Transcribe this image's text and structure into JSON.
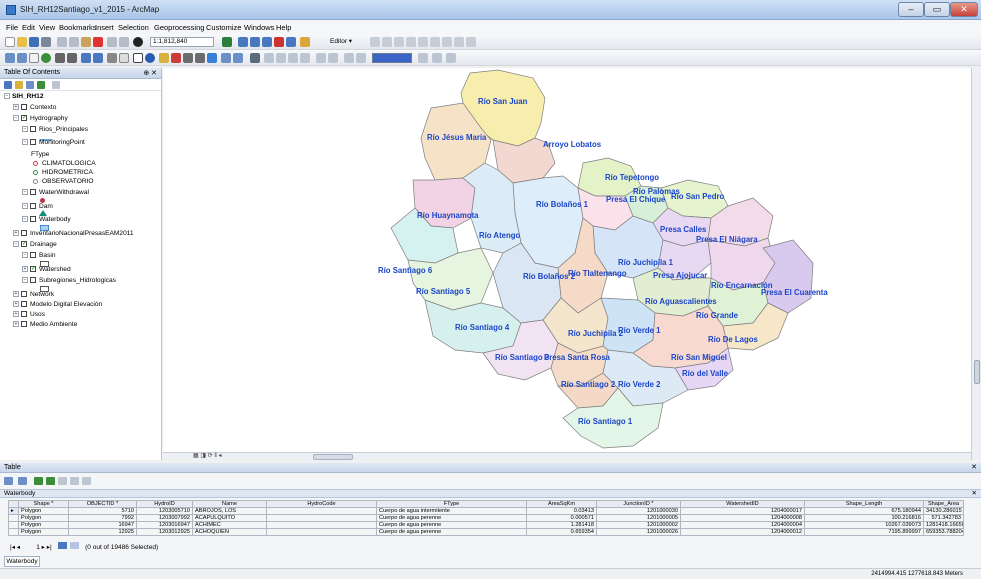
{
  "window": {
    "title": "SIH_RH12Santiago_v1_2015 - ArcMap",
    "min": "–",
    "max": "▭",
    "close": "✕"
  },
  "menu": [
    "File",
    "Edit",
    "View",
    "Bookmarks",
    "Insert",
    "Selection",
    "Geoprocessing",
    "Customize",
    "Windows",
    "Help"
  ],
  "toolbar": {
    "scale": "1:1,812,840",
    "editor": "Editor ▾"
  },
  "toc": {
    "title": "Table Of Contents",
    "items": [
      {
        "label": "SIH_RH12",
        "level": 0,
        "expand": "−",
        "check": null,
        "bold": true
      },
      {
        "label": "Contexto",
        "level": 1,
        "expand": "+",
        "check": ""
      },
      {
        "label": "Hydrography",
        "level": 1,
        "expand": "−",
        "check": "✓"
      },
      {
        "label": "Rios_Principales",
        "level": 2,
        "expand": "−",
        "check": ""
      },
      {
        "label": "MonitoringPoint",
        "level": 2,
        "expand": "−",
        "check": ""
      },
      {
        "label": "FType",
        "level": 3,
        "expand": null,
        "check": null
      },
      {
        "label": "CLIMATOLOGICA",
        "level": 3,
        "expand": null,
        "check": null,
        "sym": "circle-red"
      },
      {
        "label": "HIDROMETRICA",
        "level": 3,
        "expand": null,
        "check": null,
        "sym": "circle-green"
      },
      {
        "label": "OBSERVATORIO",
        "level": 3,
        "expand": null,
        "check": null,
        "sym": "circle-gray"
      },
      {
        "label": "WaterWithdrawal",
        "level": 2,
        "expand": "−",
        "check": ""
      },
      {
        "label": "Dam",
        "level": 2,
        "expand": "−",
        "check": ""
      },
      {
        "label": "Waterbody",
        "level": 2,
        "expand": "−",
        "check": ""
      },
      {
        "label": "InventarioNacionalPresasEAM2011",
        "level": 1,
        "expand": "+",
        "check": ""
      },
      {
        "label": "Drainage",
        "level": 1,
        "expand": "−",
        "check": "✓"
      },
      {
        "label": "Basin",
        "level": 2,
        "expand": "−",
        "check": ""
      },
      {
        "label": "Watershed",
        "level": 2,
        "expand": "+",
        "check": "✓"
      },
      {
        "label": "Subregiones_Hidrologicas",
        "level": 2,
        "expand": "−",
        "check": ""
      },
      {
        "label": "Network",
        "level": 1,
        "expand": "+",
        "check": ""
      },
      {
        "label": "Modelo Digital Elevación",
        "level": 1,
        "expand": "+",
        "check": ""
      },
      {
        "label": "Usos",
        "level": 1,
        "expand": "+",
        "check": ""
      },
      {
        "label": "Medio Ambiente",
        "level": 1,
        "expand": "+",
        "check": ""
      }
    ]
  },
  "map": {
    "labels": [
      "Río San Juan",
      "Río Jésus María",
      "Arroyo Lobatos",
      "Río Tepetongo",
      "Río Palomas",
      "Río San Pedro",
      "Presa El Chique",
      "Río Bolaños 1",
      "Río Huaynamota",
      "Río Atengo",
      "Presa Calles",
      "Presa El Niágara",
      "Río Juchipila 1",
      "Río Santiago 6",
      "Río Bolaños 2",
      "Río Tlaltenango",
      "Presa Ajojucar",
      "Río Encarnación",
      "Presa El Cuarenta",
      "Río Santiago 5",
      "Río Aguascalientes",
      "Río Grande",
      "Río Santiago 4",
      "Río Juchipila 2",
      "Río Verde 1",
      "Río De Lagos",
      "Río Santiago 3",
      "Presa Santa Rosa",
      "Río San Miguel",
      "Río del Valle",
      "Río Santiago 2",
      "Río Verde 2",
      "Río Santiago 1"
    ]
  },
  "table": {
    "panel_title": "Table",
    "layer": "Waterbody",
    "columns": [
      "Shape *",
      "OBJECTID *",
      "HydroID",
      "Name",
      "HydroCode",
      "FType",
      "AreaSqKm",
      "JunctionID *",
      "WatershedID",
      "Shape_Length",
      "Shape_Area"
    ],
    "rows": [
      [
        "Polygon",
        "5710",
        "1203005710",
        "ABROJOS, LOS",
        "",
        "Cuerpo de agua intermitente",
        "0.03413",
        "1201000030",
        "1204000017",
        "675.180944",
        "34130.286015"
      ],
      [
        "Polygon",
        "7992",
        "1203007992",
        "ACAPULQUITO",
        "",
        "Cuerpo de agua perenne",
        "0.000571",
        "1201000005",
        "1204000008",
        "100.216816",
        "571.342783"
      ],
      [
        "Polygon",
        "16947",
        "1203016947",
        "ACHIMEC",
        "",
        "Cuerpo de agua perenne",
        "1.281418",
        "1201000002",
        "1204000004",
        "10267.039073",
        "1281418.166503"
      ],
      [
        "Polygon",
        "12925",
        "1203012925",
        "ACHOQUIEN",
        "",
        "Cuerpo de agua perenne",
        "0.659354",
        "1201000026",
        "1204000012",
        "7195.899997",
        "659353.788204"
      ]
    ],
    "selection": "(0 out of 19486 Selected)",
    "record": "1"
  },
  "status": {
    "coords": "2414994.415  1277618.843 Meters"
  }
}
